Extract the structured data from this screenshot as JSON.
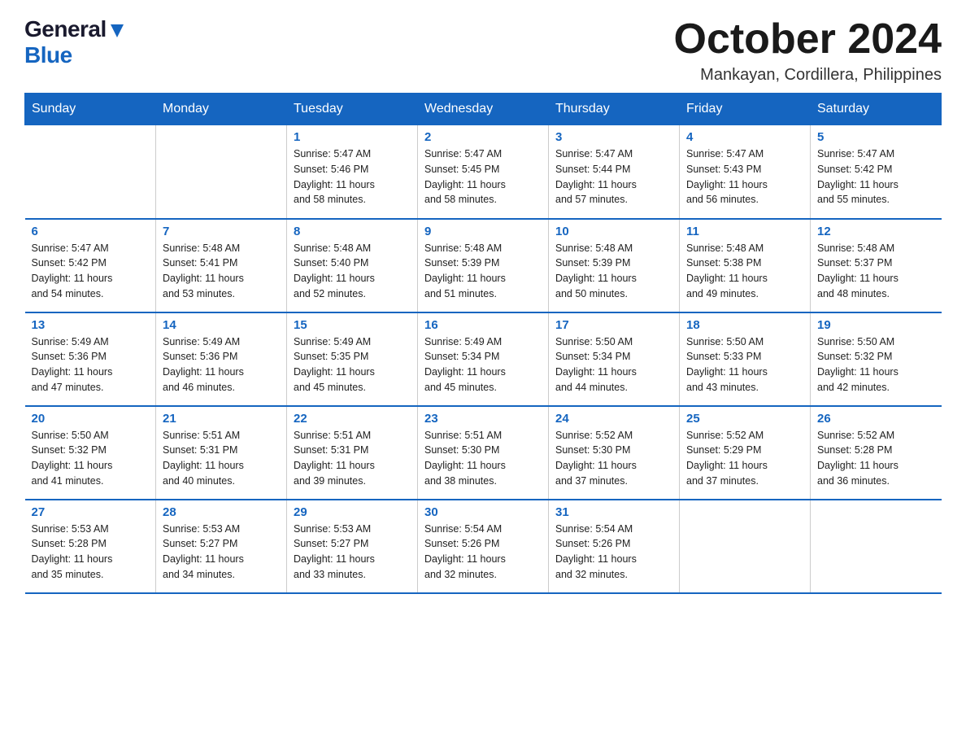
{
  "logo": {
    "general": "General",
    "blue": "Blue"
  },
  "title": "October 2024",
  "location": "Mankayan, Cordillera, Philippines",
  "headers": [
    "Sunday",
    "Monday",
    "Tuesday",
    "Wednesday",
    "Thursday",
    "Friday",
    "Saturday"
  ],
  "weeks": [
    [
      {
        "day": "",
        "info": ""
      },
      {
        "day": "",
        "info": ""
      },
      {
        "day": "1",
        "info": "Sunrise: 5:47 AM\nSunset: 5:46 PM\nDaylight: 11 hours\nand 58 minutes."
      },
      {
        "day": "2",
        "info": "Sunrise: 5:47 AM\nSunset: 5:45 PM\nDaylight: 11 hours\nand 58 minutes."
      },
      {
        "day": "3",
        "info": "Sunrise: 5:47 AM\nSunset: 5:44 PM\nDaylight: 11 hours\nand 57 minutes."
      },
      {
        "day": "4",
        "info": "Sunrise: 5:47 AM\nSunset: 5:43 PM\nDaylight: 11 hours\nand 56 minutes."
      },
      {
        "day": "5",
        "info": "Sunrise: 5:47 AM\nSunset: 5:42 PM\nDaylight: 11 hours\nand 55 minutes."
      }
    ],
    [
      {
        "day": "6",
        "info": "Sunrise: 5:47 AM\nSunset: 5:42 PM\nDaylight: 11 hours\nand 54 minutes."
      },
      {
        "day": "7",
        "info": "Sunrise: 5:48 AM\nSunset: 5:41 PM\nDaylight: 11 hours\nand 53 minutes."
      },
      {
        "day": "8",
        "info": "Sunrise: 5:48 AM\nSunset: 5:40 PM\nDaylight: 11 hours\nand 52 minutes."
      },
      {
        "day": "9",
        "info": "Sunrise: 5:48 AM\nSunset: 5:39 PM\nDaylight: 11 hours\nand 51 minutes."
      },
      {
        "day": "10",
        "info": "Sunrise: 5:48 AM\nSunset: 5:39 PM\nDaylight: 11 hours\nand 50 minutes."
      },
      {
        "day": "11",
        "info": "Sunrise: 5:48 AM\nSunset: 5:38 PM\nDaylight: 11 hours\nand 49 minutes."
      },
      {
        "day": "12",
        "info": "Sunrise: 5:48 AM\nSunset: 5:37 PM\nDaylight: 11 hours\nand 48 minutes."
      }
    ],
    [
      {
        "day": "13",
        "info": "Sunrise: 5:49 AM\nSunset: 5:36 PM\nDaylight: 11 hours\nand 47 minutes."
      },
      {
        "day": "14",
        "info": "Sunrise: 5:49 AM\nSunset: 5:36 PM\nDaylight: 11 hours\nand 46 minutes."
      },
      {
        "day": "15",
        "info": "Sunrise: 5:49 AM\nSunset: 5:35 PM\nDaylight: 11 hours\nand 45 minutes."
      },
      {
        "day": "16",
        "info": "Sunrise: 5:49 AM\nSunset: 5:34 PM\nDaylight: 11 hours\nand 45 minutes."
      },
      {
        "day": "17",
        "info": "Sunrise: 5:50 AM\nSunset: 5:34 PM\nDaylight: 11 hours\nand 44 minutes."
      },
      {
        "day": "18",
        "info": "Sunrise: 5:50 AM\nSunset: 5:33 PM\nDaylight: 11 hours\nand 43 minutes."
      },
      {
        "day": "19",
        "info": "Sunrise: 5:50 AM\nSunset: 5:32 PM\nDaylight: 11 hours\nand 42 minutes."
      }
    ],
    [
      {
        "day": "20",
        "info": "Sunrise: 5:50 AM\nSunset: 5:32 PM\nDaylight: 11 hours\nand 41 minutes."
      },
      {
        "day": "21",
        "info": "Sunrise: 5:51 AM\nSunset: 5:31 PM\nDaylight: 11 hours\nand 40 minutes."
      },
      {
        "day": "22",
        "info": "Sunrise: 5:51 AM\nSunset: 5:31 PM\nDaylight: 11 hours\nand 39 minutes."
      },
      {
        "day": "23",
        "info": "Sunrise: 5:51 AM\nSunset: 5:30 PM\nDaylight: 11 hours\nand 38 minutes."
      },
      {
        "day": "24",
        "info": "Sunrise: 5:52 AM\nSunset: 5:30 PM\nDaylight: 11 hours\nand 37 minutes."
      },
      {
        "day": "25",
        "info": "Sunrise: 5:52 AM\nSunset: 5:29 PM\nDaylight: 11 hours\nand 37 minutes."
      },
      {
        "day": "26",
        "info": "Sunrise: 5:52 AM\nSunset: 5:28 PM\nDaylight: 11 hours\nand 36 minutes."
      }
    ],
    [
      {
        "day": "27",
        "info": "Sunrise: 5:53 AM\nSunset: 5:28 PM\nDaylight: 11 hours\nand 35 minutes."
      },
      {
        "day": "28",
        "info": "Sunrise: 5:53 AM\nSunset: 5:27 PM\nDaylight: 11 hours\nand 34 minutes."
      },
      {
        "day": "29",
        "info": "Sunrise: 5:53 AM\nSunset: 5:27 PM\nDaylight: 11 hours\nand 33 minutes."
      },
      {
        "day": "30",
        "info": "Sunrise: 5:54 AM\nSunset: 5:26 PM\nDaylight: 11 hours\nand 32 minutes."
      },
      {
        "day": "31",
        "info": "Sunrise: 5:54 AM\nSunset: 5:26 PM\nDaylight: 11 hours\nand 32 minutes."
      },
      {
        "day": "",
        "info": ""
      },
      {
        "day": "",
        "info": ""
      }
    ]
  ]
}
